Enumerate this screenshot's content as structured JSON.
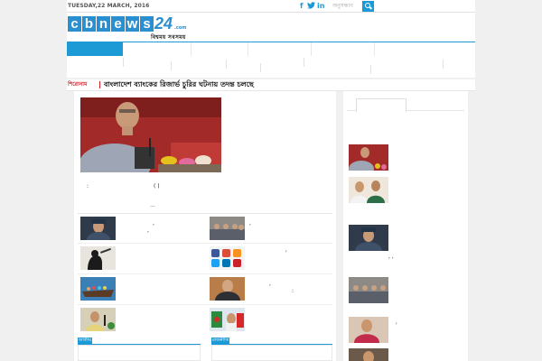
{
  "topbar": {
    "date": "TUESDAY,22 MARCH, 2016",
    "social": {
      "facebook": "f",
      "twitter": "🐦",
      "linkedin": "in"
    },
    "search_placeholder": "অনুসন্ধান"
  },
  "logo": {
    "letters": [
      "c",
      "b",
      "n",
      "e",
      "w",
      "s"
    ],
    "number": "24",
    "suffix": ".com",
    "tagline": "বিশ্বময় সবসময়"
  },
  "breaking": {
    "label": "শিরোনাম",
    "headline": "বাংলাদেশ ব্যাংকের রিজার্ভ চুরির ঘটনায় তদন্ত চলছে"
  },
  "lead": {
    "caption_prefix": ":",
    "caption_bracket": "(        )",
    "more": "..."
  },
  "stories": [
    {
      "title_marks": [
        ",",
        ","
      ]
    },
    {
      "title_marks": [
        ",",
        ""
      ]
    },
    {
      "title_marks": [
        "",
        ""
      ]
    },
    {
      "title_marks": [
        "'",
        ""
      ]
    },
    {
      "title_marks": [
        "",
        ""
      ]
    },
    {
      "title_marks": [
        ",",
        ":"
      ]
    },
    {
      "title_marks": [
        "",
        ""
      ]
    },
    {
      "title_marks": [
        "",
        ""
      ]
    }
  ],
  "sections": {
    "left_tag": "জাতীয়",
    "right_tag": "রাজনীতি"
  },
  "sidebar": {
    "items": [
      {
        "title": ""
      },
      {
        "title": ""
      },
      {
        "title": ",                            ,"
      },
      {
        "title": ""
      },
      {
        "title": "'"
      },
      {
        "title": ""
      }
    ]
  }
}
